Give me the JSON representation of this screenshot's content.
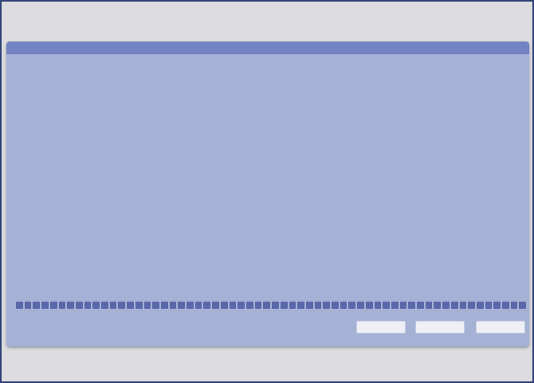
{
  "dialog": {
    "title": "",
    "status_label": "",
    "progress": {
      "fraction": 1.0,
      "segments": 60
    },
    "buttons": [
      {
        "label": ""
      },
      {
        "label": ""
      },
      {
        "label": ""
      }
    ]
  },
  "colors": {
    "outer_border": "#2f3f78",
    "background": "#dcdcde",
    "dialog_body": "#a6b1d6",
    "titlebar": "#7382c2",
    "progress_fill": "#5a67a8",
    "button_face": "#eef0f6"
  }
}
